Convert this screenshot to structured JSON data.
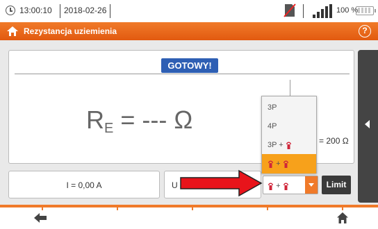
{
  "status_bar": {
    "time": "13:00:10",
    "date": "2018-02-26",
    "battery_percent": "100 %",
    "icons": [
      "clock-icon",
      "sim-card-crossed-icon",
      "signal-icon",
      "battery-icon"
    ]
  },
  "title_bar": {
    "title": "Rezystancja uziemienia",
    "home_icon": "home-icon",
    "help_label": "?"
  },
  "measurement": {
    "status": "GOTOWY!",
    "result_symbol": "R",
    "result_subscript": "E",
    "result_value": " = --- Ω",
    "limit_value": "= 200 Ω"
  },
  "fields": {
    "current": "I = 0,00 A",
    "voltage_prefix": "U"
  },
  "mode_select": {
    "options": [
      "3P",
      "4P",
      "3P +",
      "+"
    ],
    "selected_index": 3,
    "selected_label": "+"
  },
  "limit_button": "Limit",
  "colors": {
    "accent": "#f07a2a",
    "status_badge": "#2e5fb4",
    "selected_option": "#f7a11b",
    "clamp_icon": "#d0263a",
    "annotation_arrow": "#e8141b"
  },
  "footer": {
    "back_icon": "back-arrow-icon",
    "home_icon": "home-icon"
  }
}
